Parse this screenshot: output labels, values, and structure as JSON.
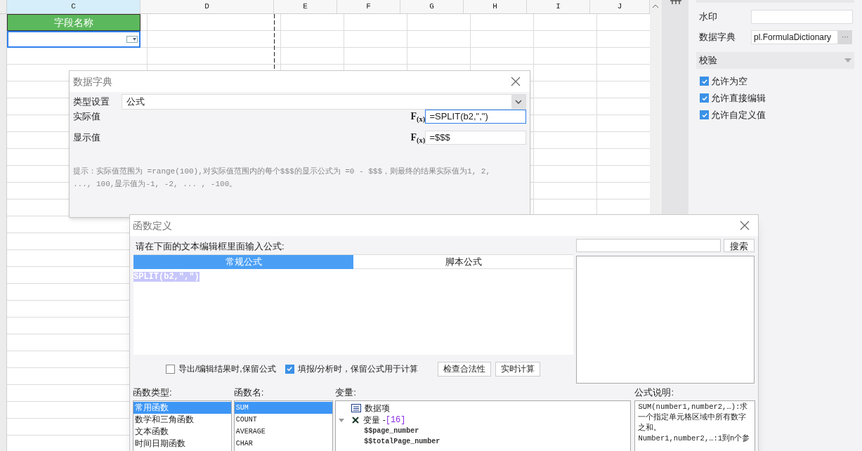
{
  "sheet": {
    "columns": [
      {
        "label": "C",
        "selected": true
      },
      {
        "label": "D",
        "selected": false
      },
      {
        "label": "E",
        "selected": false
      },
      {
        "label": "F",
        "selected": false
      },
      {
        "label": "G",
        "selected": false
      },
      {
        "label": "H",
        "selected": false
      },
      {
        "label": "I",
        "selected": false
      },
      {
        "label": "J",
        "selected": false
      }
    ],
    "header_cell": "字段名称",
    "dropdown_cell": {
      "selected": true
    }
  },
  "right_panel": {
    "watermark_label": "水印",
    "dictionary_label": "数据字典",
    "dictionary_value": "pl.FormulaDictionary",
    "dictionary_button": "···",
    "section": "校验",
    "checks": [
      {
        "label": "允许为空",
        "checked": true
      },
      {
        "label": "允许直接编辑",
        "checked": true
      },
      {
        "label": "允许自定义值",
        "checked": true
      }
    ]
  },
  "data_dictionary_dialog": {
    "title": "数据字典",
    "type_label": "类型设置",
    "type_value": "公式",
    "rows": [
      {
        "label": "实际值",
        "fx": "F$_{(x)}$",
        "value": "=SPLIT(b2,\",\")",
        "focused": true
      },
      {
        "label": "显示值",
        "fx": "F$_{(x)}$",
        "value": "=$$$",
        "focused": false
      }
    ],
    "hint": "提示：实际值范围为 =range(100),对实际值范围内的每个$$$的显示公式为 =0 - $$$，则最终的结果实际值为1, 2, ..., 100,显示值为-1, -2, ... , -100。"
  },
  "function_dialog": {
    "title": "函数定义",
    "prompt": "请在下面的文本编辑框里面输入公式:",
    "tabs": [
      {
        "label": "常规公式",
        "selected": true
      },
      {
        "label": "脚本公式",
        "selected": false
      }
    ],
    "formula": "SPLIT(b2,\",\")",
    "formula_selected": true,
    "search_button": "搜索",
    "options": [
      {
        "label": "导出/编辑结果时,保留公式",
        "checked": false
      },
      {
        "label": "填报/分析时，保留公式用于计算",
        "checked": true
      }
    ],
    "buttons": [
      "检查合法性",
      "实时计算"
    ],
    "function_types": {
      "label": "函数类型:",
      "items": [
        {
          "label": "常用函数",
          "selected": true
        },
        {
          "label": "数学和三角函数",
          "selected": false
        },
        {
          "label": "文本函数",
          "selected": false
        },
        {
          "label": "时间日期函数",
          "selected": false
        }
      ]
    },
    "function_names": {
      "label": "函数名:",
      "items": [
        {
          "label": "SUM",
          "selected": true
        },
        {
          "label": "COUNT",
          "selected": false
        },
        {
          "label": "AVERAGE",
          "selected": false
        },
        {
          "label": "CHAR",
          "selected": false
        }
      ]
    },
    "variables": {
      "label": "变量:",
      "items": [
        {
          "label": "数据项",
          "kind": "item"
        },
        {
          "label": "变量 - ",
          "count": "[16]",
          "kind": "group",
          "expanded": true,
          "children": [
            {
              "label": "$$page_number"
            },
            {
              "label": "$$totalPage_number"
            }
          ]
        }
      ]
    },
    "description": {
      "label": "公式说明:",
      "paragraphs": [
        "SUM(number1,number2,…):求一个指定单元格区域中所有数字之和。",
        "Number1,number2,…:1到n个参"
      ]
    }
  }
}
